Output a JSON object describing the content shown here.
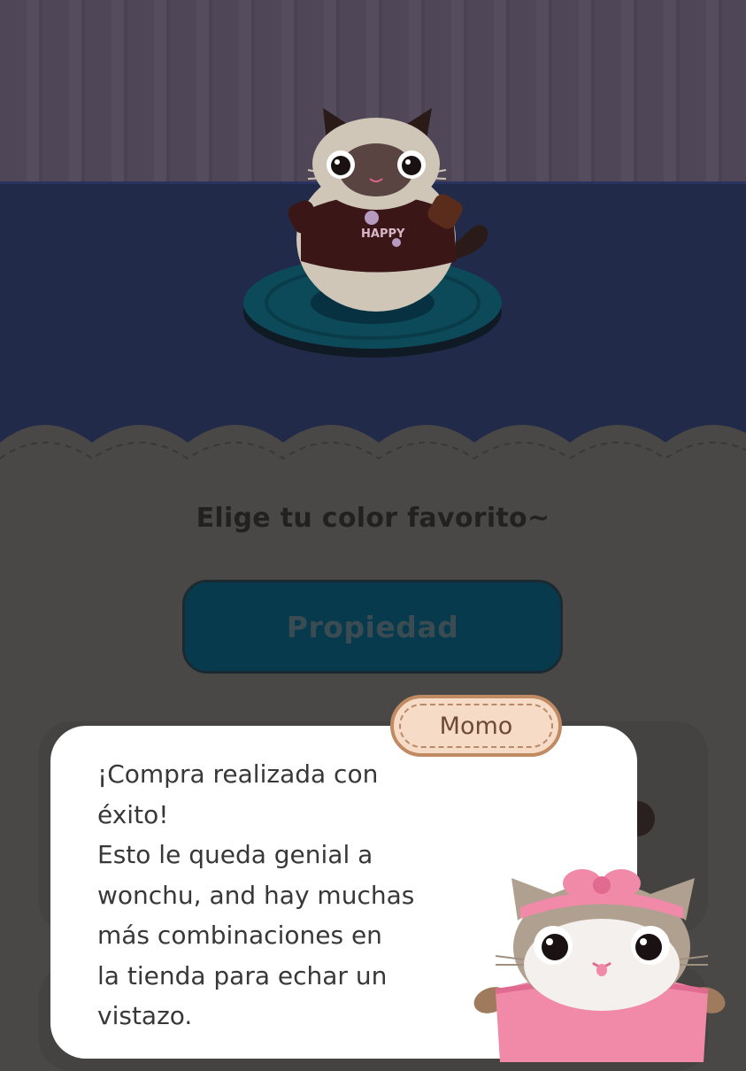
{
  "prompt": "Elige tu color favorito~",
  "property_button": "Propiedad",
  "pet": {
    "shirt_text": "HAPPY"
  },
  "dialog": {
    "speaker": "Momo",
    "lines": [
      "¡Compra realizada con",
      "éxito!",
      "Esto le queda genial a",
      "wonchu, and hay muchas",
      "más combinaciones en",
      "la tienda para echar un",
      "vistazo."
    ]
  },
  "colors": {
    "wall": "#4f4757",
    "floor": "#222a4a",
    "panel": "#4a4846",
    "button": "#083a4d",
    "dialog": "#ffffff",
    "name_tag": "#f6dcc6",
    "mascot_pink": "#f08aa8"
  }
}
